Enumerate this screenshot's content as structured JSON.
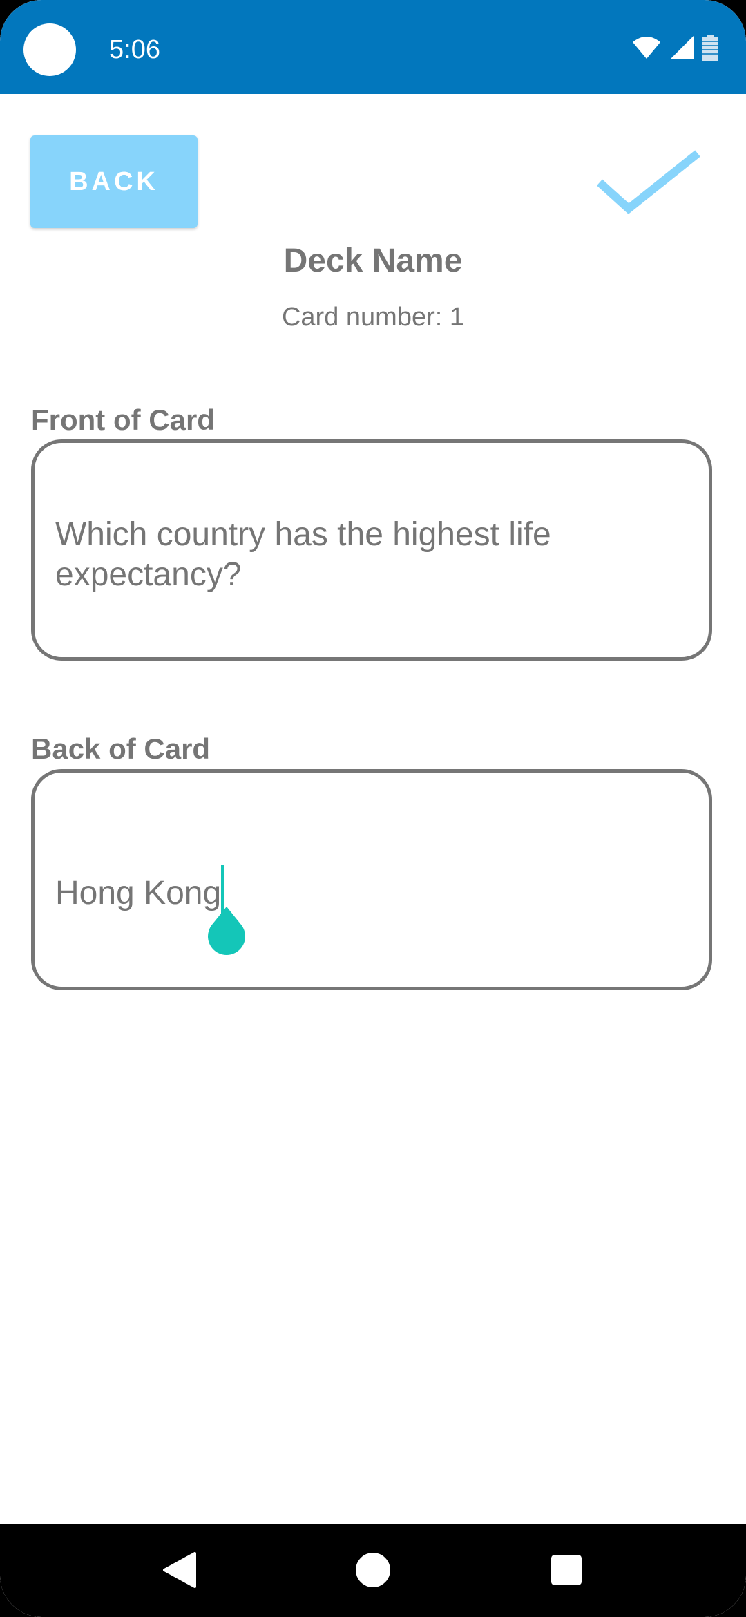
{
  "status_bar": {
    "time": "5:06",
    "icons": [
      "camera-cutout-icon",
      "wifi-icon",
      "signal-icon",
      "battery-icon"
    ]
  },
  "toolbar": {
    "back_label": "BACK",
    "confirm_icon": "checkmark-icon"
  },
  "header": {
    "deck_name": "Deck Name",
    "card_number": "Card number: 1"
  },
  "front": {
    "label": "Front of Card",
    "value": "Which country has the highest life expectancy?"
  },
  "back": {
    "label": "Back of Card",
    "value": "Hong Kong"
  },
  "colors": {
    "status_bar": "#0277bd",
    "accent_button": "#87d4fb",
    "text_gray": "#757575",
    "cursor": "#14c6b8"
  },
  "nav_bar": {
    "icons": [
      "nav-back-icon",
      "nav-home-icon",
      "nav-recents-icon"
    ]
  }
}
